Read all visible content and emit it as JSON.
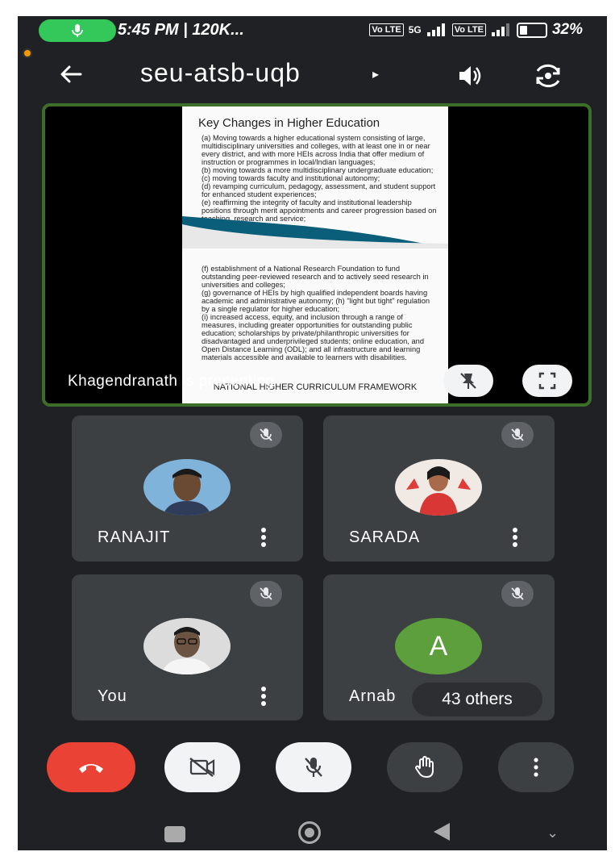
{
  "status_bar": {
    "time": "5:45 PM | 120K...",
    "network": "5G",
    "sim_badge_1": "Vo LTE",
    "sim_badge_2": "Vo LTE",
    "battery": "32%"
  },
  "header": {
    "meeting_code": "seu-atsb-uqb",
    "caret": "▸"
  },
  "presentation": {
    "slide_title": "Key Changes in Higher Education",
    "slide_text_top": "(a) Moving towards a higher educational system consisting of large, multidisciplinary universities and colleges, with at least one in or near every district, and with more HEIs across India that offer medium of instruction or programmes in local/Indian languages;\n(b) moving towards a more multidisciplinary undergraduate education;\n(c) moving towards faculty and institutional autonomy;\n(d) revamping curriculum, pedagogy, assessment, and student support for enhanced student experiences;\n(e) reaffirming the integrity of faculty and institutional leadership positions through merit appointments and career progression based on teaching, research and service;",
    "slide_text_bottom": "(f) establishment of a National Research Foundation to fund outstanding peer-reviewed research and to actively seed research in universities and colleges;\n(g) governance of HEIs by high qualified independent boards having academic and administrative autonomy; (h) \"light but tight\" regulation by a single regulator for higher education;\n(i) increased access, equity, and inclusion through a range of measures, including greater opportunities for outstanding public education; scholarships by private/philanthropic universities for disadvantaged and underprivileged students; online education, and Open Distance Learning (ODL); and all infrastructure and learning materials accessible and available to learners with disabilities.",
    "slide_footer": "NATIONAL HIGHER CURRICULUM FRAMEWORK",
    "presenter_label": "Khagendranath is presenting"
  },
  "participants": [
    {
      "name": "RANAJIT",
      "muted": true
    },
    {
      "name": "SARADA",
      "muted": true
    },
    {
      "name": "You",
      "muted": true
    },
    {
      "name": "Arnab",
      "muted": true,
      "avatar_letter": "A"
    }
  ],
  "others_count_label": "43 others",
  "colors": {
    "background": "#202124",
    "tile": "#3c4043",
    "end_call": "#ea4335",
    "active_border": "#3c6e2a",
    "letter_avatar": "#5c9f3c"
  }
}
